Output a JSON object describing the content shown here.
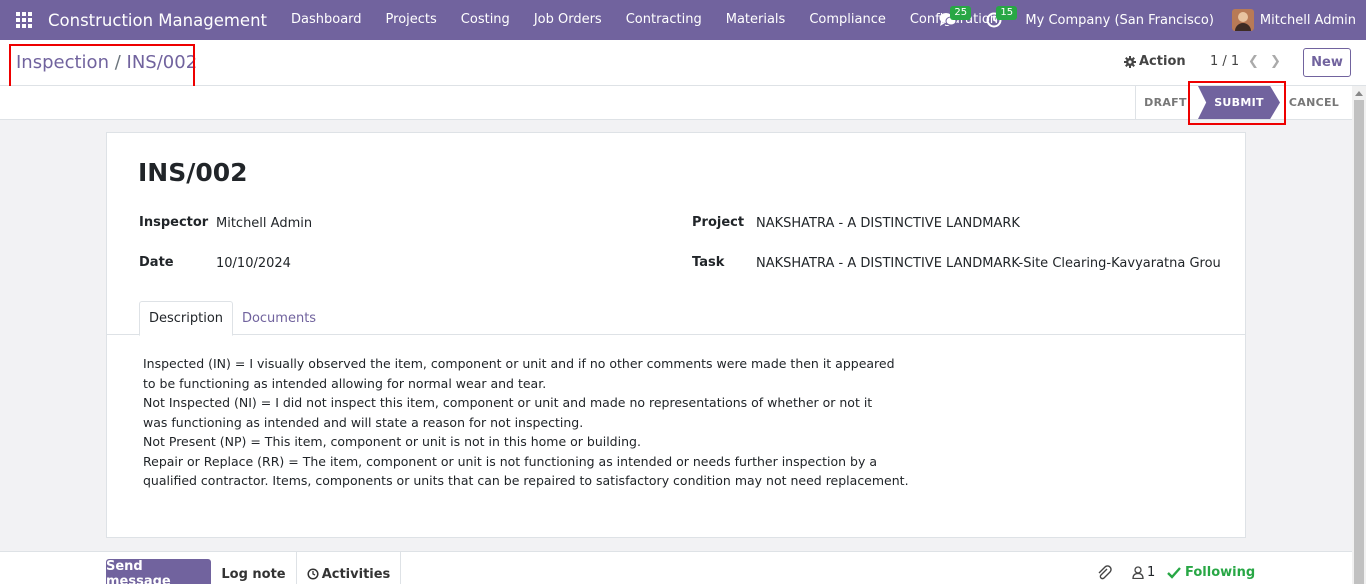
{
  "navbar": {
    "app_name": "Construction Management",
    "menu": [
      "Dashboard",
      "Projects",
      "Costing",
      "Job Orders",
      "Contracting",
      "Materials",
      "Compliance",
      "Configuration"
    ],
    "messages_count": "25",
    "activities_count": "15",
    "company": "My Company (San Francisco)",
    "user": "Mitchell Admin"
  },
  "control": {
    "breadcrumb_parent": "Inspection",
    "breadcrumb_sep": "/",
    "breadcrumb_current": "INS/002",
    "action_label": "Action",
    "pager": "1 / 1",
    "new_label": "New"
  },
  "statusbar": {
    "stages": [
      "DRAFT",
      "SUBMIT",
      "CANCEL"
    ],
    "current_stage": "SUBMIT"
  },
  "form": {
    "title": "INS/002",
    "inspector_label": "Inspector",
    "inspector": "Mitchell Admin",
    "date_label": "Date",
    "date": "10/10/2024",
    "project_label": "Project",
    "project": "NAKSHATRA - A DISTINCTIVE LANDMARK",
    "task_label": "Task",
    "task": "NAKSHATRA - A DISTINCTIVE LANDMARK-Site Clearing-Kavyaratna Grou",
    "tabs": [
      "Description",
      "Documents"
    ],
    "description_lines": [
      "Inspected (IN) = I visually observed the item, component or unit and if no other comments were made then it appeared",
      "to be functioning as intended allowing for normal wear and tear.",
      "Not Inspected (NI) = I did not inspect this item, component or unit and made no representations of whether or not it",
      "was functioning as intended and will state a reason for not inspecting.",
      "Not Present (NP) = This item, component or unit is not in this home or building.",
      "Repair or Replace (RR) = The item, component or unit is not functioning as intended or needs further inspection by a",
      "qualified contractor. Items, components or units that can be repaired to satisfactory condition may not need replacement."
    ]
  },
  "chatter": {
    "send_message": "Send message",
    "log_note": "Log note",
    "activities": "Activities",
    "followers_count": "1",
    "following": "Following"
  },
  "colors": {
    "brand": "#71639e",
    "highlight": "#ee0000",
    "success": "#28a745"
  }
}
